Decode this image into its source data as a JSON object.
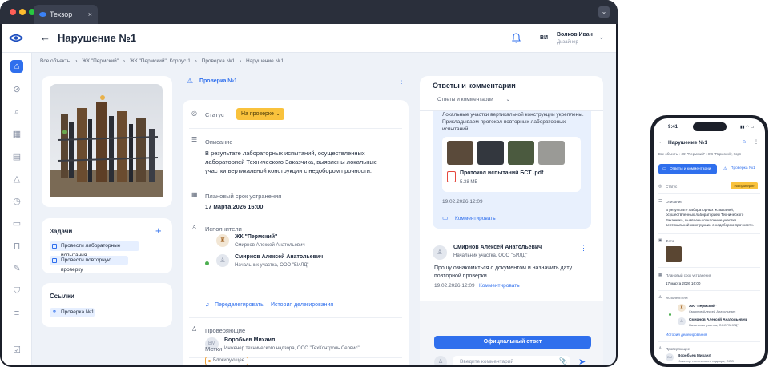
{
  "browser": {
    "tab_title": "Техзор",
    "tab_close": "×",
    "menu": "⌄"
  },
  "header": {
    "back": "←",
    "title": "Нарушение №1",
    "user_initials": "ВИ",
    "user_name": "Волков Иван",
    "user_role": "Дизайнер",
    "chevron": "⌄"
  },
  "breadcrumbs": [
    "Все объекты",
    "ЖК \"Пермский\"",
    "ЖК \"Пермский\", Корпус 1",
    "Проверка №1",
    "Нарушение №1"
  ],
  "breadcrumb_sep": "›",
  "tasks": {
    "title": "Задачи",
    "add": "+",
    "items": [
      "Провести лабораторные испытания",
      "Провести повторную проверку"
    ]
  },
  "links": {
    "title": "Ссылки",
    "items": [
      "Проверка №1"
    ]
  },
  "detail": {
    "inspection_link": "Проверка №1",
    "more": "⋮",
    "status_label": "Статус",
    "status_value": "На проверке",
    "description_label": "Описание",
    "description_text": "В результате лабораторных испытаний, осуществленных лабораторией Технического Заказчика, выявлены локальные участки вертикальной конструкции с недобором прочности.",
    "due_label": "Плановый срок устранения",
    "due_value": "17 марта 2026 16:00",
    "executors_label": "Исполнители",
    "executor1_name": "ЖК \"Пермский\"",
    "executor1_sub": "Смирнов Алексей Анатольевич",
    "executor2_name": "Смирнов Алексей Анатольевич",
    "executor2_sub": "Начальник участка, ООО \"БИЛД\"",
    "redelegate": "Переделегировать",
    "delegation_history": "История делегирования",
    "reviewers_label": "Проверяющие",
    "reviewer_initials": "ВМ",
    "reviewer_name": "Воробьев Михаил",
    "reviewer_sub": "Инженер технического надзора, ООО \"ТехКонтроль Сервис\"",
    "tags_label": "Метки",
    "tag1": "Блокирующее"
  },
  "comments": {
    "title": "Ответы и комментарии",
    "filter": "Ответы и комментарии",
    "c1_text": "Локальные участки вертикальной конструкции укреплены. Прикладываем протокол повторных лабораторных испытаний",
    "c1_file": "Протокол испытаний БСТ .pdf",
    "c1_size": "5.38 МБ",
    "c1_date": "19.02.2026 12:09",
    "c1_action": "Комментировать",
    "c2_author": "Смирнов Алексей Анатольевич",
    "c2_role": "Начальник участка, ООО \"БИЛД\"",
    "c2_text": "Прошу ознакомиться с документом и назначить дату повторной проверки",
    "c2_date": "19.02.2026 12:09",
    "c2_action": "Комментировать",
    "official": "Официальный ответ",
    "input_placeholder": "Введите комментарий",
    "send": "➤",
    "attach": "📎"
  },
  "phone": {
    "time": "9:41",
    "title": "Нарушение №1",
    "crumbs": "Все объекты  ›  ЖК \"Пермский\"  ›  ЖК \"Пермский\", Корп",
    "tab_active": "Ответы и комментарии",
    "tab2": "Проверка №1",
    "status_label": "Статус",
    "status_value": "На проверке",
    "description_label": "Описание",
    "description_text": "В результате лабораторных испытаний, осуществленных лабораторией Технического Заказчика, выявлены локальные участки вертикальной конструкции с недобором прочности.",
    "photo_label": "Фото",
    "due_label": "Плановый срок устранения",
    "due_value": "17 марта 2026 16:00",
    "executors_label": "Исполнители",
    "e1_name": "ЖК \"Пермский\"",
    "e1_sub": "Смирнов Алексей Анатольевич",
    "e2_name": "Смирнов Алексей Анатольевич",
    "e2_sub": "Начальник участка, ООО \"БИЛД\"",
    "history": "История делегирования",
    "reviewers_label": "Проверяющие",
    "reviewer_name": "Воробьев Михаил",
    "reviewer_sub": "Инженер технического надзора, ООО"
  }
}
